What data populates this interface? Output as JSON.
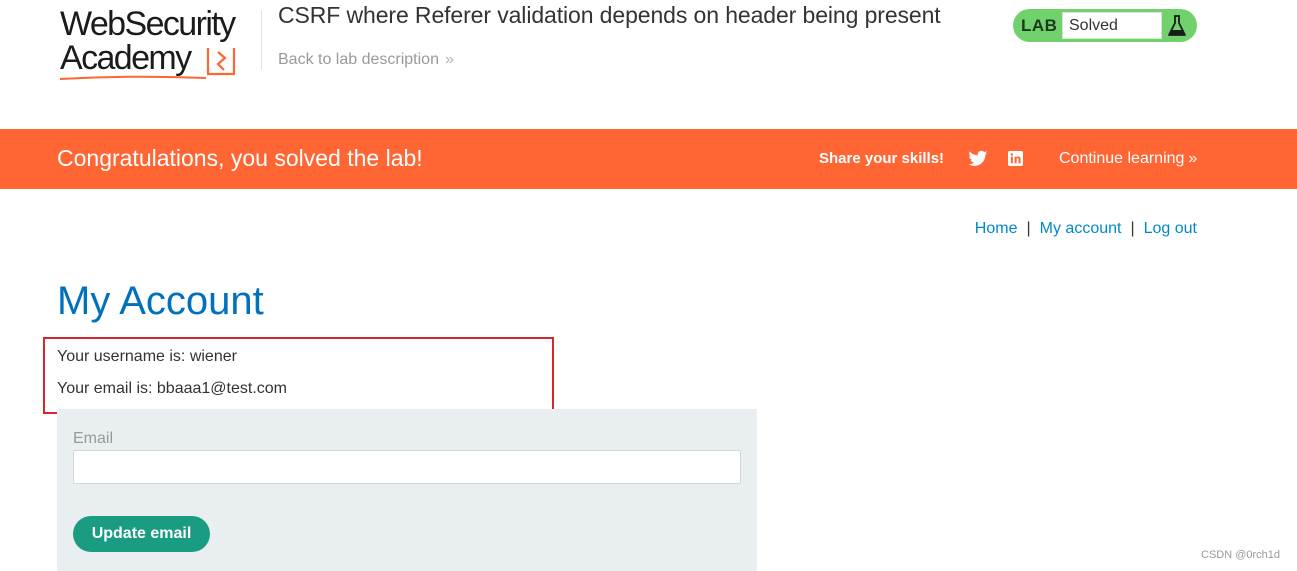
{
  "header": {
    "logo_line1": "WebSecurity",
    "logo_line2": "Academy",
    "lab_title": "CSRF where Referer validation depends on header being present",
    "back_link": "Back to lab description",
    "badge": {
      "label": "LAB",
      "status": "Solved"
    }
  },
  "banner": {
    "message": "Congratulations, you solved the lab!",
    "share_label": "Share your skills!",
    "continue_label": "Continue learning"
  },
  "nav": {
    "home": "Home",
    "separator": "|",
    "my_account": "My account",
    "log_out": "Log out"
  },
  "account": {
    "title": "My Account",
    "username_text": "Your username is: wiener",
    "email_text": "Your email is: bbaaa1@test.com"
  },
  "form": {
    "email_label": "Email",
    "email_value": "",
    "submit_label": "Update email"
  },
  "watermark": "CSDN @0rch1d",
  "colors": {
    "banner": "#ff6633",
    "title_blue": "#0071bc",
    "link_blue": "#0088cc",
    "badge_green": "#70d16d",
    "button_teal": "#1a9c82",
    "highlight_red": "#d9262c"
  },
  "icons": {
    "back_chevron": "double-chevron-right-icon",
    "flask": "flask-icon",
    "twitter": "twitter-icon",
    "linkedin": "linkedin-icon",
    "continue_chevron": "double-chevron-right-icon"
  }
}
